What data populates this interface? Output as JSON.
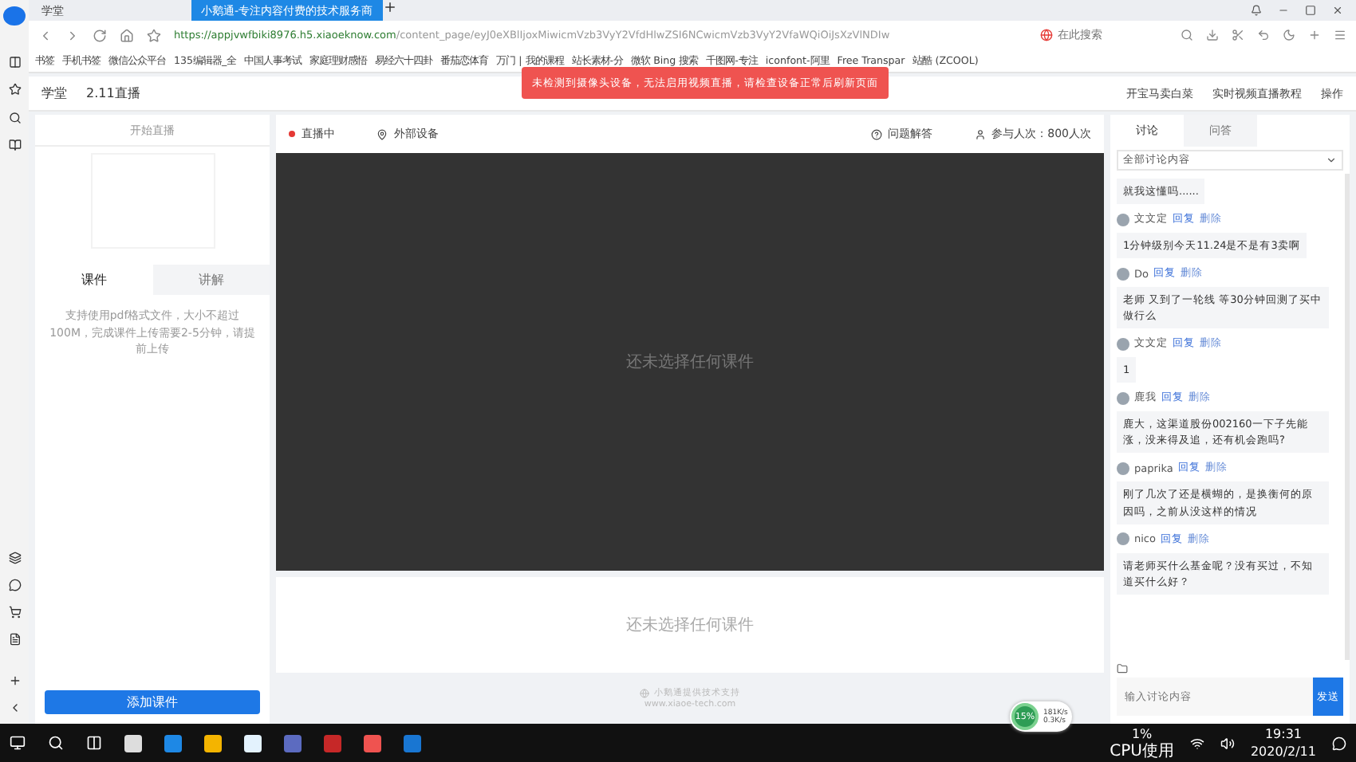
{
  "browser": {
    "tabs": [
      {
        "title": "学堂",
        "selected": false
      },
      {
        "title": "小鹅通-专注内容付费的技术服务商",
        "selected": true
      }
    ],
    "url_host": "https://appjvwfbiki8976.h5.xiaoeknow.com",
    "url_path": "/content_page/eyJ0eXBlIjoxMiwicmVzb3VyY2VfdHlwZSI6NCwicmVzb3VyY2VfaWQiOiJsXzVlNDIw",
    "search_placeholder": "在此搜索",
    "bookmarks": [
      "书签",
      "手机书签",
      "微信公众平台",
      "135编辑器_全",
      "中国人事考试",
      "家庭理财感悟",
      "易经六十四卦",
      "番茄恋体育",
      "万门 | 我的课程",
      "站长素材-分",
      "微软 Bing 搜索",
      "千图网-专注",
      "iconfont-阿里",
      "Free Transpar",
      "站酷 (ZCOOL)"
    ]
  },
  "header": {
    "school": "学堂",
    "title": "2.11直播",
    "actions": [
      "开宝马卖白菜",
      "实时视频直播教程",
      "操作"
    ]
  },
  "toast": "未检测到摄像头设备，无法启用视频直播，请检查设备正常后刷新页面",
  "left_panel": {
    "start_label": "开始直播",
    "tabs": [
      {
        "label": "课件",
        "selected": true
      },
      {
        "label": "讲解",
        "selected": false
      }
    ],
    "hint": "支持使用pdf格式文件，大小不超过100M，完成课件上传需要2-5分钟，请提前上传",
    "add_button": "添加课件"
  },
  "stage": {
    "status": "直播中",
    "device": "外部设备",
    "qa": "问题解答",
    "viewers": "参与人次：800人次",
    "video_placeholder": "还未选择任何课件",
    "slide_placeholder": "还未选择任何课件",
    "footer": "小鹅通提供技术支持",
    "footer_url": "www.xiaoe-tech.com"
  },
  "chat": {
    "tabs": [
      {
        "label": "讨论",
        "selected": true
      },
      {
        "label": "问答",
        "selected": false
      }
    ],
    "filter": "全部讨论内容",
    "messages": [
      {
        "text": "就我这懂吗......"
      },
      {
        "author": "文文定",
        "reply": "回复",
        "delete": "删除",
        "text": "1分钟级别今天11.24是不是有3卖啊"
      },
      {
        "author": "Do",
        "reply": "回复",
        "delete": "删除",
        "text": "老师 又到了一轮线 等30分钟回测了买中做行么"
      },
      {
        "author": "文文定",
        "reply": "回复",
        "delete": "删除",
        "text": "1"
      },
      {
        "author": "鹿我",
        "reply": "回复",
        "delete": "删除",
        "text": "鹿大，这渠道股份002160一下子先能涨，没来得及追，还有机会跑吗?"
      },
      {
        "author": "paprika",
        "reply": "回复",
        "delete": "删除",
        "text": "刚了几次了还是横蝴的，是换衡何的原因吗，之前从没这样的情况"
      },
      {
        "author": "nico",
        "reply": "回复",
        "delete": "删除",
        "text": "请老师买什么基金呢？没有买过，不知道买什么好？"
      }
    ],
    "input_placeholder": "输入讨论内容",
    "send": "发送"
  },
  "net_monitor": {
    "load": "15%",
    "up": "181K/s",
    "down": "0.3K/s"
  },
  "taskbar": {
    "cpu": "1%",
    "cpu_label": "CPU使用",
    "time": "19:31",
    "date": "2020/2/11"
  }
}
